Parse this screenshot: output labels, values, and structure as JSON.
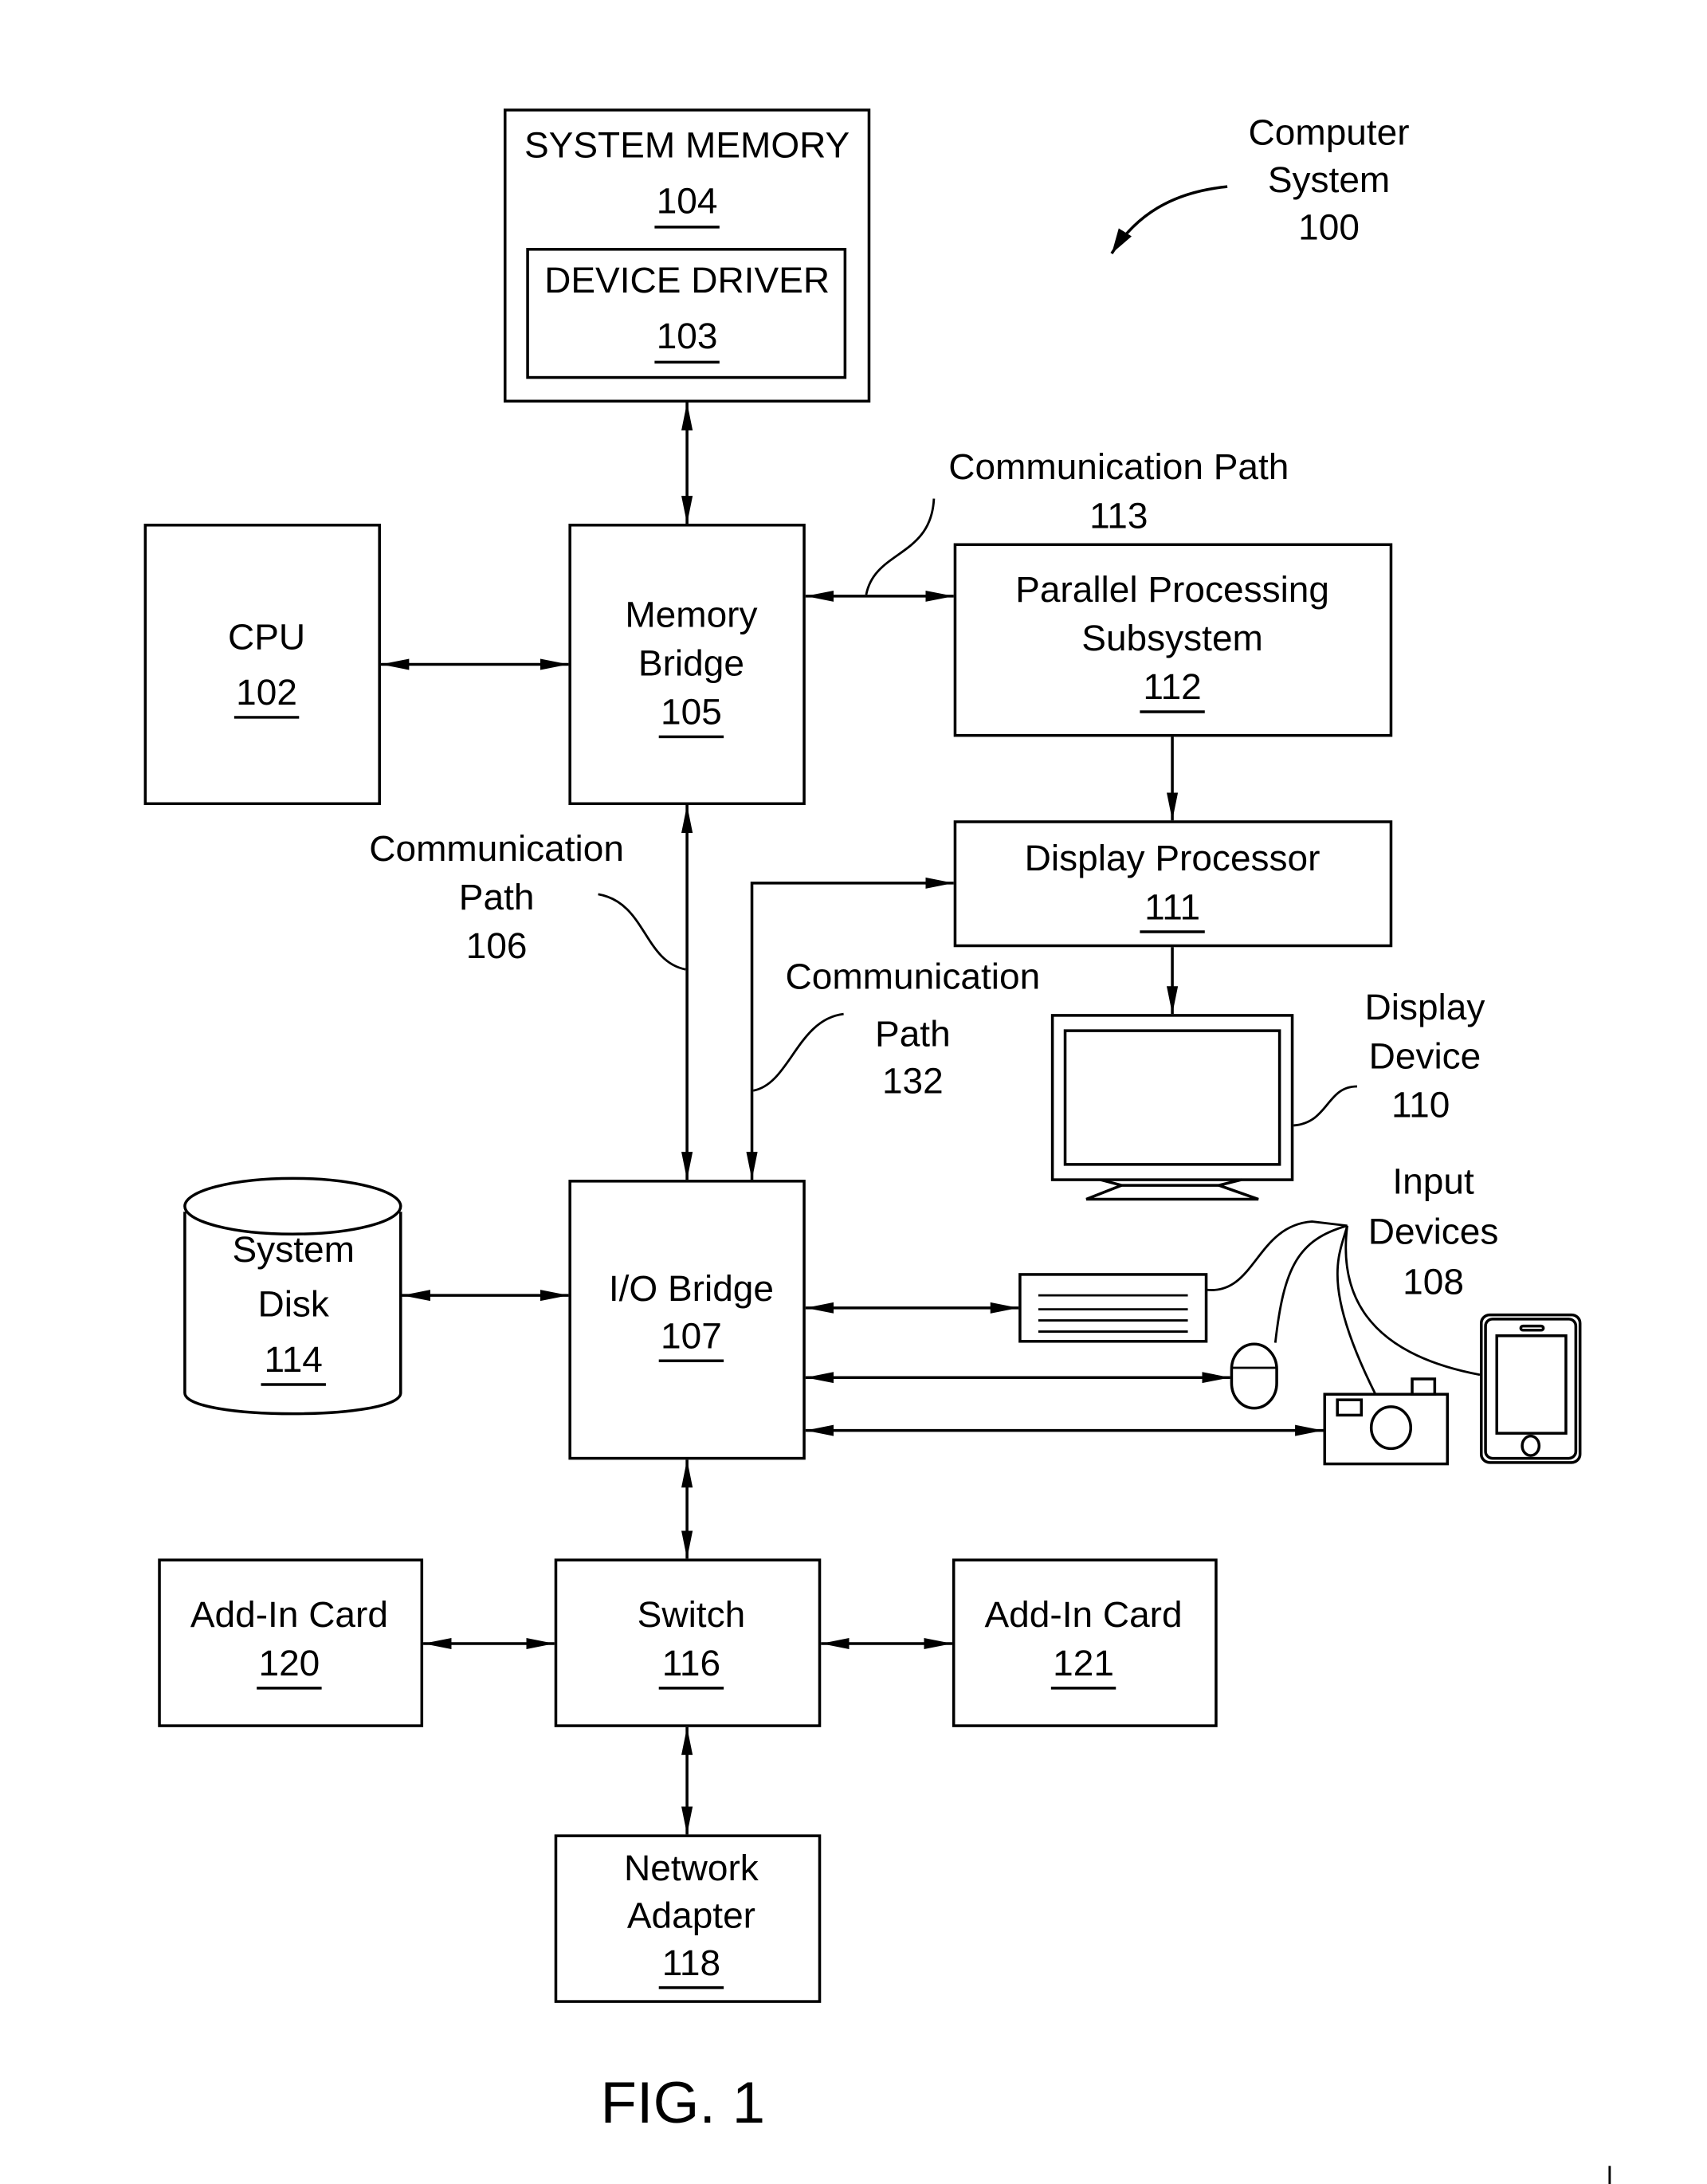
{
  "figure_label": "FIG. 1",
  "system": {
    "title_lines": [
      "Computer",
      "System",
      "100"
    ]
  },
  "blocks": {
    "system_memory": {
      "lines": [
        "SYSTEM MEMORY"
      ],
      "ref": "104"
    },
    "device_driver": {
      "lines": [
        "DEVICE DRIVER"
      ],
      "ref": "103"
    },
    "cpu": {
      "lines": [
        "CPU"
      ],
      "ref": "102"
    },
    "memory_bridge": {
      "lines": [
        "Memory",
        "Bridge"
      ],
      "ref": "105"
    },
    "parallel_processing": {
      "lines": [
        "Parallel Processing",
        "Subsystem"
      ],
      "ref": "112"
    },
    "display_processor": {
      "lines": [
        "Display Processor"
      ],
      "ref": "111"
    },
    "io_bridge": {
      "lines": [
        "I/O Bridge"
      ],
      "ref": "107"
    },
    "system_disk": {
      "lines": [
        "System",
        "Disk"
      ],
      "ref": "114"
    },
    "switch": {
      "lines": [
        "Switch"
      ],
      "ref": "116"
    },
    "add_in_card_120": {
      "lines": [
        "Add-In Card"
      ],
      "ref": "120"
    },
    "add_in_card_121": {
      "lines": [
        "Add-In Card"
      ],
      "ref": "121"
    },
    "network_adapter": {
      "lines": [
        "Network",
        "Adapter"
      ],
      "ref": "118"
    }
  },
  "callouts": {
    "comm_path_113": [
      "Communication Path",
      "113"
    ],
    "comm_path_106": [
      "Communication",
      "Path",
      "106"
    ],
    "comm_path_132": [
      "Communication",
      "Path",
      "132"
    ],
    "display_device": [
      "Display",
      "Device",
      "110"
    ],
    "input_devices": [
      "Input",
      "Devices",
      "108"
    ]
  },
  "devices": [
    "keyboard",
    "mouse",
    "camera",
    "smartphone",
    "monitor"
  ]
}
